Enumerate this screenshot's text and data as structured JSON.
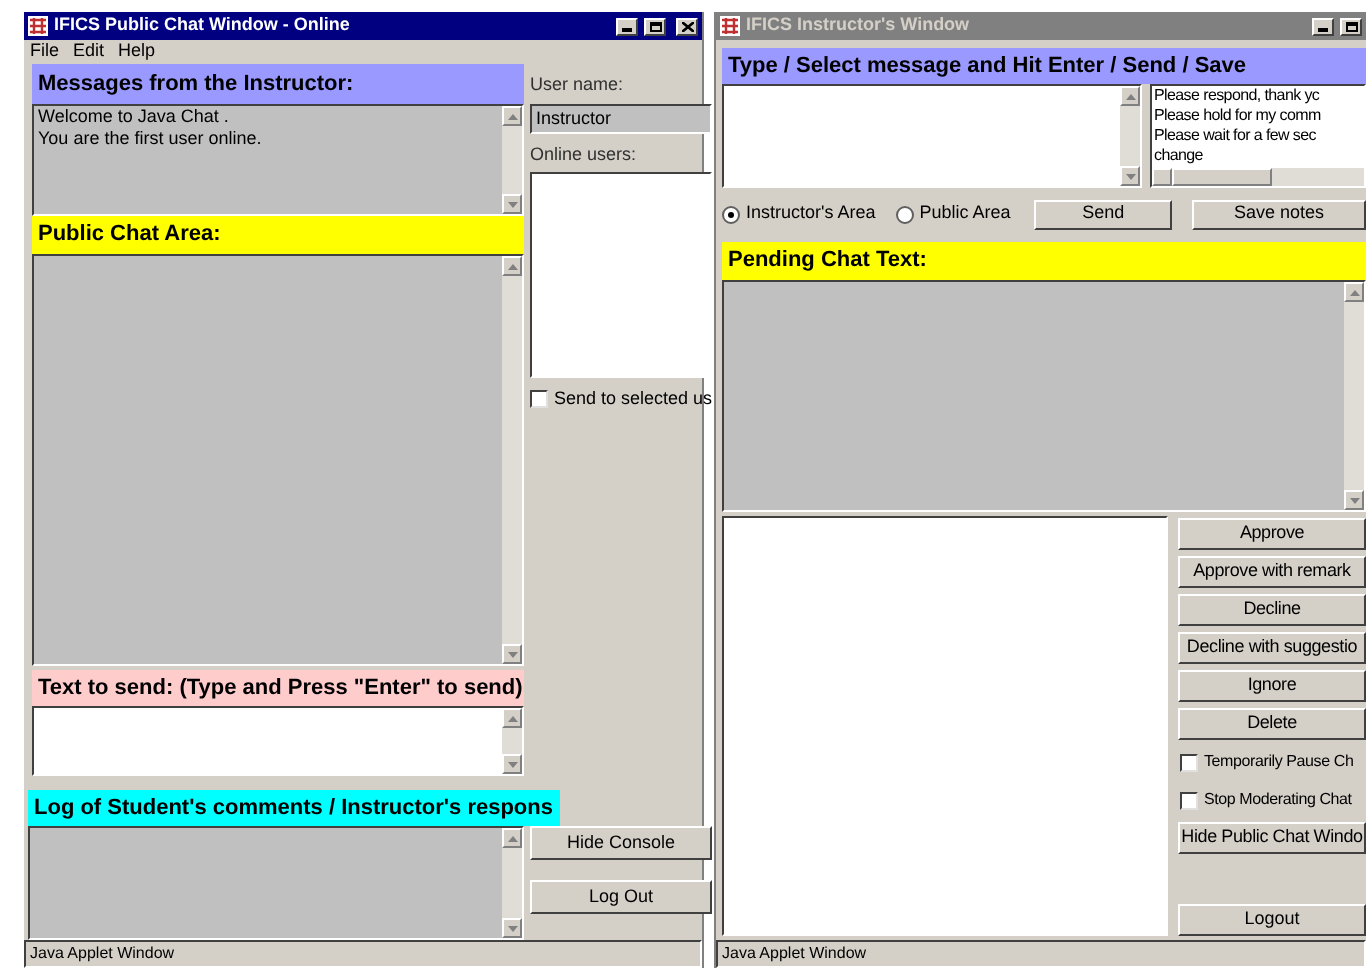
{
  "public_chat_window": {
    "title": "IFICS Public Chat Window - Online",
    "active": true,
    "menu": [
      "File",
      "Edit",
      "Help"
    ],
    "instructor_header": "Messages from the Instructor:",
    "messages": [
      "Welcome to Java Chat .",
      "You are the first user online."
    ],
    "public_header": "Public Chat Area:",
    "send_header": "Text to send: (Type and Press \"Enter\" to send)",
    "log_header": "Log of Student's comments / Instructor's respons",
    "user_name_label": "User name:",
    "user_name_value": "Instructor",
    "online_users_label": "Online users:",
    "send_to_selected": {
      "label": "Send to selected us",
      "checked": false
    },
    "buttons": [
      "Hide Console",
      "Log Out"
    ],
    "status_bar": "Java Applet Window"
  },
  "instructor_window": {
    "title": "IFICS Instructor's Window",
    "active": false,
    "header": "Type / Select message and Hit Enter / Send / Save",
    "canned_messages": [
      "Please respond, thank yc",
      "Please hold for my comm",
      "Please wait for a few sec",
      "change"
    ],
    "radios": [
      {
        "label": "Instructor's Area",
        "selected": true
      },
      {
        "label": "Public Area",
        "selected": false
      }
    ],
    "buttons": [
      "Send",
      "Save notes"
    ],
    "pending_header": "Pending Chat Text:",
    "actions": [
      {
        "kind": "button",
        "label": "Approve"
      },
      {
        "kind": "button",
        "label": "Approve with remark"
      },
      {
        "kind": "button",
        "label": "Decline"
      },
      {
        "kind": "button",
        "label": "Decline with suggestio"
      },
      {
        "kind": "button",
        "label": "Ignore"
      },
      {
        "kind": "button",
        "label": "Delete"
      },
      {
        "kind": "checkbox",
        "label": "Temporarily Pause Ch",
        "checked": false
      },
      {
        "kind": "checkbox",
        "label": "Stop Moderating Chat",
        "checked": false
      },
      {
        "kind": "button",
        "label": "Hide Public Chat Windo"
      },
      {
        "kind": "logout",
        "label": "Logout"
      }
    ],
    "status_bar": "Java Applet Window"
  }
}
